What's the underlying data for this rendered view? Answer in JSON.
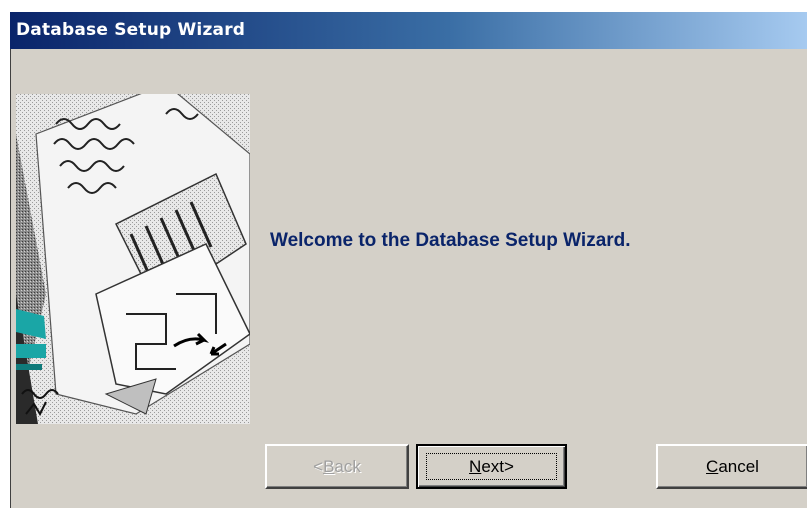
{
  "window": {
    "title": "Database Setup Wizard"
  },
  "main": {
    "welcome_text": "Welcome to the Database Setup Wizard.",
    "illustration_icon": "wizard-documents-illustration"
  },
  "buttons": {
    "back": {
      "prefix": "< ",
      "mnemonic": "B",
      "rest": "ack",
      "enabled": false
    },
    "next": {
      "mnemonic": "N",
      "rest": "ext",
      "suffix": " >",
      "enabled": true,
      "default": true
    },
    "cancel": {
      "mnemonic": "C",
      "rest": "ancel",
      "enabled": true
    }
  },
  "colors": {
    "dialog_face": "#d4d0c8",
    "titlebar_start": "#0a246a",
    "titlebar_end": "#a6caf0",
    "welcome_text": "#0a246a",
    "disabled_text": "#a0a0a0"
  }
}
